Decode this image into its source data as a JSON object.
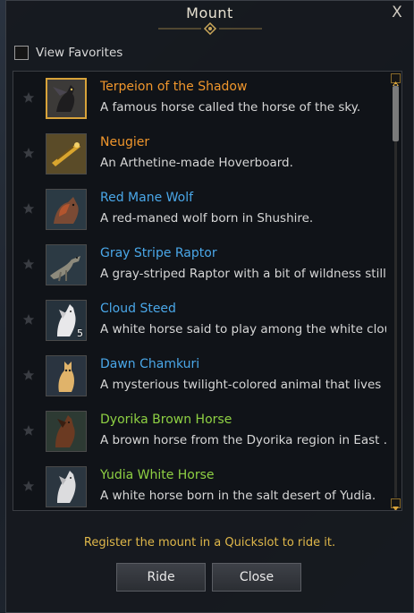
{
  "window": {
    "title": "Mount",
    "close_glyph": "X"
  },
  "filters": {
    "view_favorites_label": "View Favorites",
    "view_favorites_checked": false
  },
  "mounts": [
    {
      "name": "Terpeion of the Shadow",
      "desc": "A famous horse called the horse of the sky.",
      "name_color": "#f0962c",
      "selected": true,
      "icon": "dark-winged-horse-icon",
      "count": ""
    },
    {
      "name": "Neugier",
      "desc": "An Arthetine-made Hoverboard.",
      "name_color": "#f0962c",
      "selected": false,
      "icon": "hoverboard-icon",
      "count": ""
    },
    {
      "name": "Red Mane Wolf",
      "desc": "A red-maned wolf born in Shushire.",
      "name_color": "#4aa7e8",
      "selected": false,
      "icon": "wolf-icon",
      "count": ""
    },
    {
      "name": "Gray Stripe Raptor",
      "desc": "A gray-striped Raptor with a bit of wildness still.",
      "name_color": "#4aa7e8",
      "selected": false,
      "icon": "raptor-icon",
      "count": ""
    },
    {
      "name": "Cloud Steed",
      "desc": "A white horse said to play among the white clou...",
      "name_color": "#4aa7e8",
      "selected": false,
      "icon": "white-horse-icon",
      "count": "5"
    },
    {
      "name": "Dawn Chamkuri",
      "desc": "A mysterious twilight-colored animal that lives ...",
      "name_color": "#4aa7e8",
      "selected": false,
      "icon": "chamkuri-icon",
      "count": ""
    },
    {
      "name": "Dyorika Brown Horse",
      "desc": "A brown horse from the Dyorika region in East ...",
      "name_color": "#8ed043",
      "selected": false,
      "icon": "brown-horse-icon",
      "count": ""
    },
    {
      "name": "Yudia White Horse",
      "desc": "A white horse born in the salt desert of Yudia.",
      "name_color": "#8ed043",
      "selected": false,
      "icon": "white-horse-icon",
      "count": ""
    }
  ],
  "footer": {
    "hint": "Register the mount in a Quickslot to ride it.",
    "ride_label": "Ride",
    "close_label": "Close"
  },
  "colors": {
    "hint": "#e0b84a",
    "accent_border": "#d8a33a"
  }
}
